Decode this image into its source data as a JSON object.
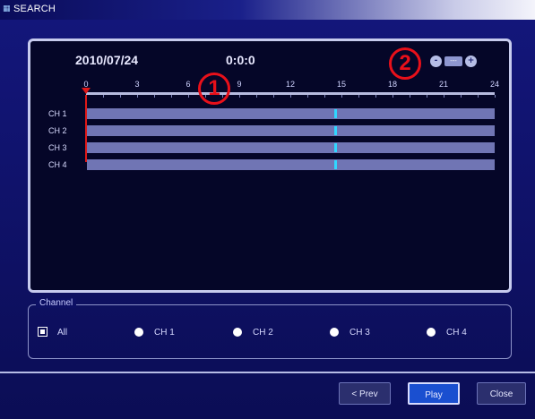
{
  "window": {
    "title": "SEARCH",
    "title_icon": "search-window-icon"
  },
  "timeline": {
    "date": "2010/07/24",
    "time": "0:0:0",
    "hour_labels": [
      "0",
      "3",
      "6",
      "9",
      "12",
      "15",
      "18",
      "21",
      "24"
    ],
    "channels": [
      {
        "label": "CH 1"
      },
      {
        "label": "CH 2"
      },
      {
        "label": "CH 3"
      },
      {
        "label": "CH 4"
      }
    ],
    "zoom": {
      "minus": "-",
      "plus": "+",
      "level": "---"
    }
  },
  "callouts": [
    {
      "number": "1"
    },
    {
      "number": "2"
    }
  ],
  "channel_group": {
    "legend": "Channel",
    "options": [
      {
        "label": "All"
      },
      {
        "label": "CH 1"
      },
      {
        "label": "CH 2"
      },
      {
        "label": "CH 3"
      },
      {
        "label": "CH 4"
      }
    ]
  },
  "buttons": {
    "prev": "< Prev",
    "play": "Play",
    "close": "Close"
  },
  "colors": {
    "background": "#0b0c4e",
    "timeline_bar": "#7075b4",
    "record_mark": "#30d6ff",
    "cursor": "#e01818",
    "callout": "#e8101a",
    "play_button": "#1a4fd0"
  }
}
